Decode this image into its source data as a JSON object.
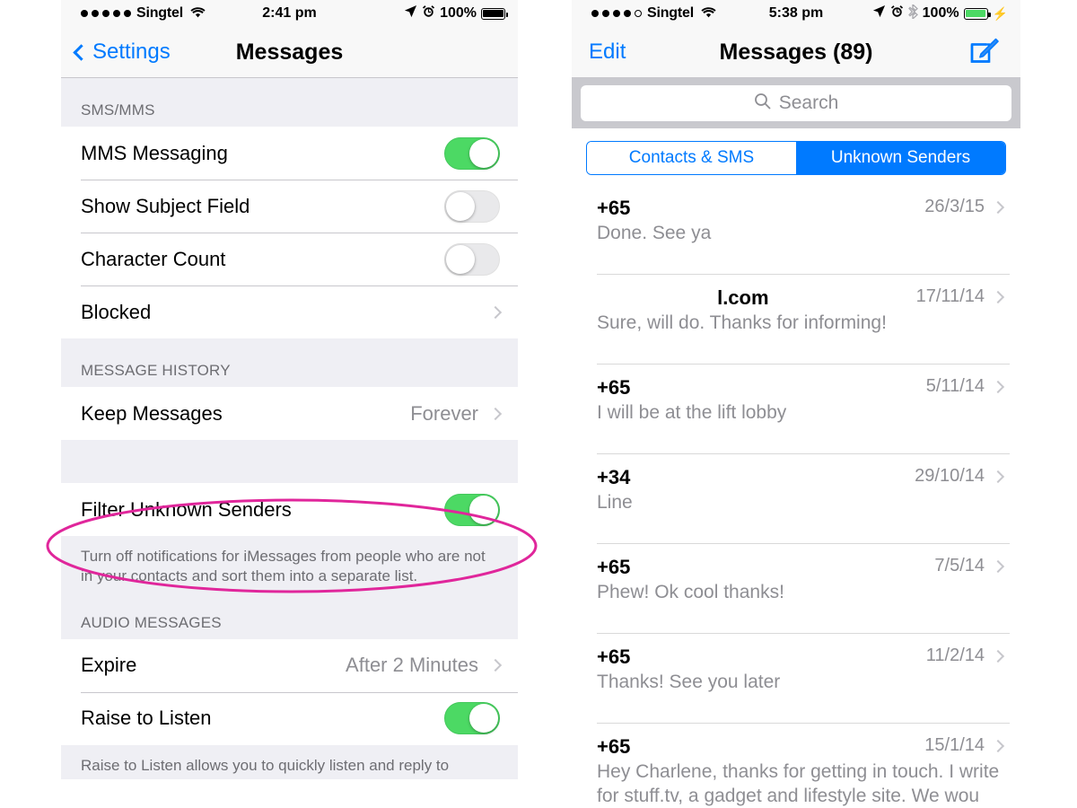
{
  "left_panel": {
    "status_bar": {
      "signal_dots": [
        true,
        true,
        true,
        true,
        true
      ],
      "carrier": "Singtel",
      "wifi_icon": "wifi-icon",
      "time": "2:41 pm",
      "location_icon": "location-arrow-icon",
      "alarm_icon": "alarm-clock-icon",
      "battery_percent": "100%",
      "battery_style": "black",
      "charging": false,
      "bluetooth": false
    },
    "nav": {
      "back_label": "Settings",
      "back_icon": "chevron-left-icon",
      "title": "Messages"
    },
    "sections": [
      {
        "header": "SMS/MMS",
        "rows": [
          {
            "label": "MMS Messaging",
            "type": "toggle",
            "on": true
          },
          {
            "label": "Show Subject Field",
            "type": "toggle",
            "on": false
          },
          {
            "label": "Character Count",
            "type": "toggle",
            "on": false
          },
          {
            "label": "Blocked",
            "type": "disclosure",
            "value": ""
          }
        ],
        "footer": ""
      },
      {
        "header": "MESSAGE HISTORY",
        "rows": [
          {
            "label": "Keep Messages",
            "type": "disclosure",
            "value": "Forever"
          }
        ],
        "footer": ""
      },
      {
        "header": "",
        "rows": [
          {
            "label": "Filter Unknown Senders",
            "type": "toggle",
            "on": true,
            "highlighted": true
          }
        ],
        "footer": "Turn off notifications for iMessages from people who are not in your contacts and sort them into a separate list."
      },
      {
        "header": "AUDIO MESSAGES",
        "rows": [
          {
            "label": "Expire",
            "type": "disclosure",
            "value": "After 2 Minutes"
          },
          {
            "label": "Raise to Listen",
            "type": "toggle",
            "on": true
          }
        ],
        "footer": "Raise to Listen allows you to quickly listen and reply to"
      }
    ],
    "annotation": {
      "shape": "ellipse",
      "color": "#e0269b",
      "target": "Filter Unknown Senders"
    }
  },
  "right_panel": {
    "status_bar": {
      "signal_dots": [
        true,
        true,
        true,
        true,
        false
      ],
      "carrier": "Singtel",
      "wifi_icon": "wifi-icon",
      "time": "5:38 pm",
      "location_icon": "location-arrow-icon",
      "alarm_icon": "alarm-clock-icon",
      "bluetooth_icon": "bluetooth-icon",
      "battery_percent": "100%",
      "battery_style": "green",
      "charging": true,
      "bluetooth": true
    },
    "nav": {
      "edit_label": "Edit",
      "title": "Messages (89)",
      "compose_icon": "compose-pencil-icon"
    },
    "search": {
      "placeholder": "Search",
      "icon": "search-icon",
      "value": ""
    },
    "segmented": {
      "options": [
        "Contacts & SMS",
        "Unknown Senders"
      ],
      "selected_index": 1
    },
    "messages": [
      {
        "sender": "+65",
        "centered": false,
        "date": "26/3/15",
        "preview": "Done. See ya"
      },
      {
        "sender": "l.com",
        "centered": true,
        "date": "17/11/14",
        "preview": "Sure, will do. Thanks for informing!"
      },
      {
        "sender": "+65",
        "centered": false,
        "date": "5/11/14",
        "preview": "I will be at the lift lobby"
      },
      {
        "sender": "+34",
        "centered": false,
        "date": "29/10/14",
        "preview": "Line"
      },
      {
        "sender": "+65",
        "centered": false,
        "date": "7/5/14",
        "preview": "Phew! Ok cool thanks!"
      },
      {
        "sender": "+65",
        "centered": false,
        "date": "11/2/14",
        "preview": "Thanks! See you later"
      },
      {
        "sender": "+65",
        "centered": false,
        "date": "15/1/14",
        "preview": "Hey Charlene, thanks for getting in touch. I write\nfor stuff.tv, a gadget and lifestyle site. We wou"
      }
    ]
  },
  "colors": {
    "accent_blue": "#007aff",
    "toggle_green": "#4cd964",
    "annotation_pink": "#e0269b",
    "group_bg": "#efeff4",
    "separator": "#c8c7cc",
    "secondary_text": "#8e8e93"
  }
}
